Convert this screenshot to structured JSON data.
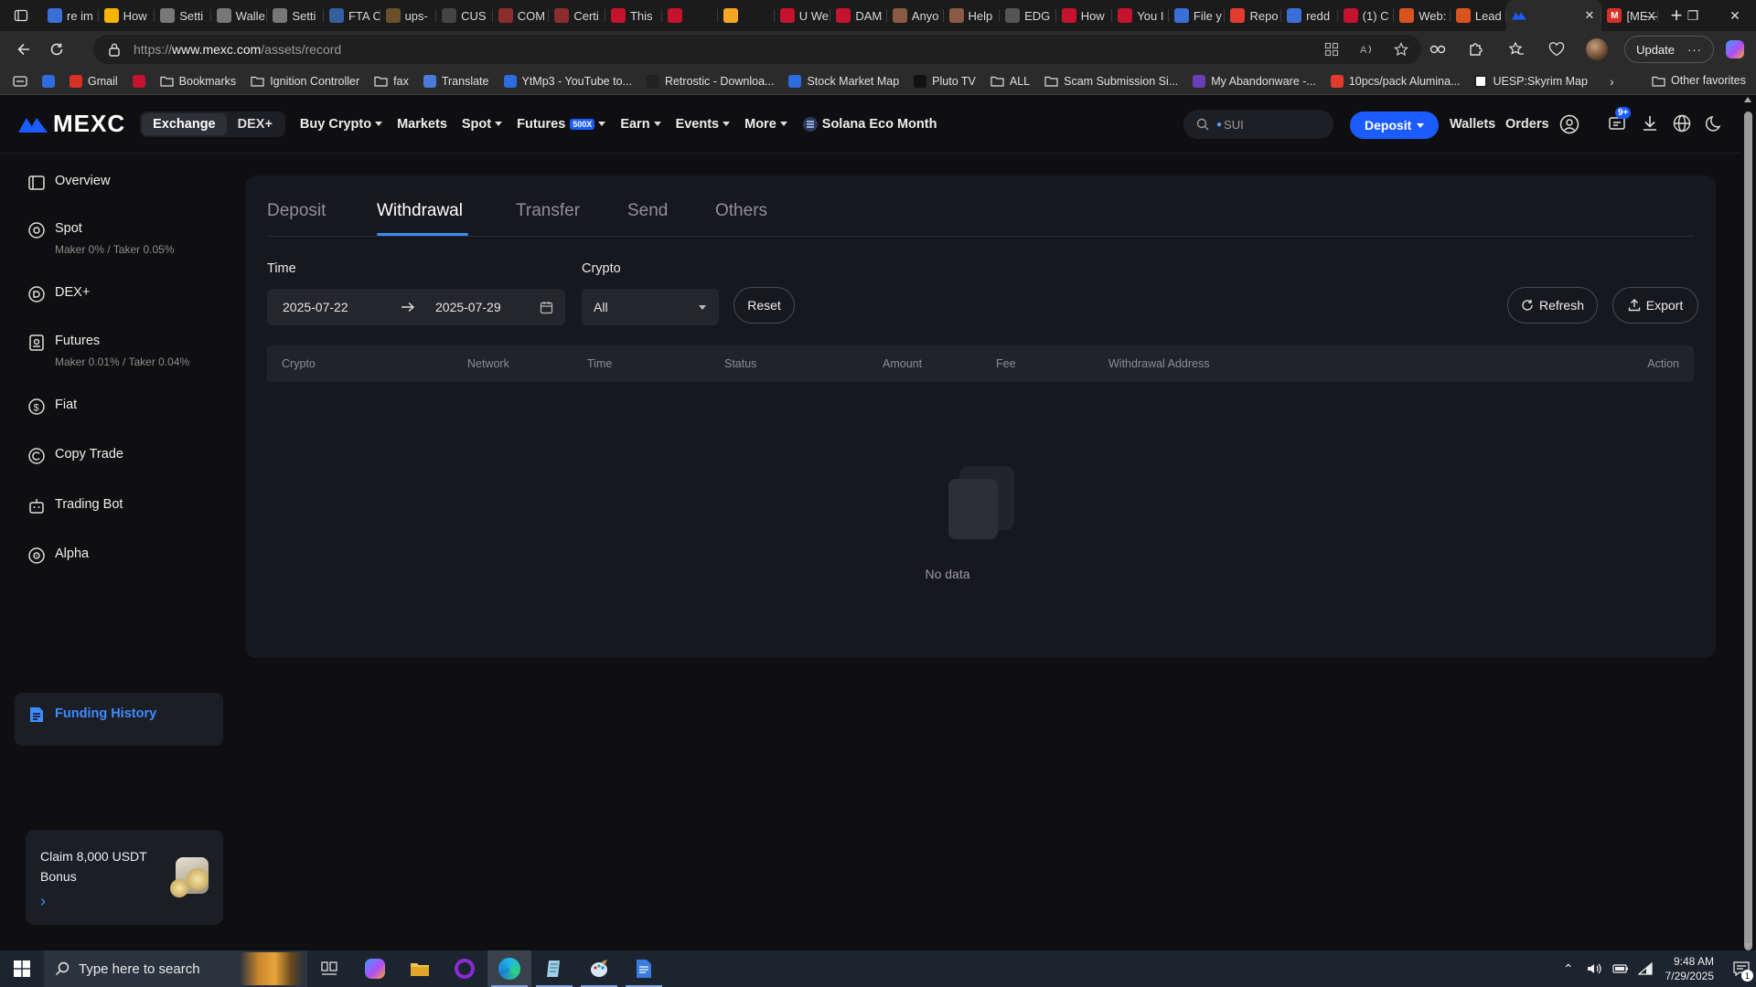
{
  "browser": {
    "tabs": [
      {
        "title": "re im",
        "color": "#3a6fd8",
        "icon": "search-favicon"
      },
      {
        "title": "How",
        "color": "#f4b400",
        "icon": "windows-favicon"
      },
      {
        "title": "Setti",
        "color": "#777777",
        "icon": "gear-favicon"
      },
      {
        "title": "Walle",
        "color": "#777777",
        "icon": "wallet-favicon"
      },
      {
        "title": "Setti",
        "color": "#777777",
        "icon": "gear-favicon"
      },
      {
        "title": "FTA C",
        "color": "#355e9c",
        "icon": "fta-favicon"
      },
      {
        "title": "ups-",
        "color": "#6b4f2b",
        "icon": "ups-favicon"
      },
      {
        "title": "CUS",
        "color": "#444444",
        "icon": "cus-favicon"
      },
      {
        "title": "COM",
        "color": "#8b2d2d",
        "icon": "com-favicon"
      },
      {
        "title": "Certi",
        "color": "#8b2d2d",
        "icon": "cert-favicon"
      },
      {
        "title": "This",
        "color": "#c4122f",
        "icon": "youtube-favicon"
      },
      {
        "title": "",
        "color": "#c4122f",
        "icon": "youtube-favicon"
      },
      {
        "title": "",
        "color": "#f5a623",
        "icon": "warning-favicon"
      },
      {
        "title": "U We",
        "color": "#c4122f",
        "icon": "youtube-favicon"
      },
      {
        "title": "DAM",
        "color": "#c4122f",
        "icon": "youtube-favicon"
      },
      {
        "title": "Anyo",
        "color": "#8a5a44",
        "icon": "reddit-favicon"
      },
      {
        "title": "Help",
        "color": "#8a5a44",
        "icon": "reddit-favicon"
      },
      {
        "title": "EDG",
        "color": "#555555",
        "icon": "edge-favicon"
      },
      {
        "title": "How",
        "color": "#c4122f",
        "icon": "youtube-favicon"
      },
      {
        "title": "You I",
        "color": "#c4122f",
        "icon": "youtube-favicon"
      },
      {
        "title": "File y",
        "color": "#3a6fd8",
        "icon": "search-favicon"
      },
      {
        "title": "Repo",
        "color": "#e23b2e",
        "icon": "report-favicon"
      },
      {
        "title": "redd",
        "color": "#3a6fd8",
        "icon": "search-favicon"
      },
      {
        "title": "(1) C",
        "color": "#c4122f",
        "icon": "youtube-favicon"
      },
      {
        "title": "Web:",
        "color": "#d9531e",
        "icon": "fire-favicon"
      },
      {
        "title": "Lead",
        "color": "#d9531e",
        "icon": "fire-favicon"
      }
    ],
    "active_tab": {
      "title": "",
      "close": "✕",
      "color": "#1a5cff"
    },
    "extra_tab": {
      "title": "[MEX",
      "color": "#d93025"
    },
    "new_tab": "+",
    "url_prefix": "https://",
    "url_domain": "www.mexc.com",
    "url_path": "/assets/record",
    "update_label": "Update",
    "bookmarks": [
      {
        "label": "",
        "color": "#2d6cdf",
        "icon": "edge-bookmark-icon"
      },
      {
        "label": "Gmail",
        "color": "#d93025",
        "icon": "gmail-icon"
      },
      {
        "label": "",
        "color": "#c4122f",
        "icon": "youtube-icon"
      },
      {
        "label": "Bookmarks",
        "color": "folder",
        "icon": "folder-icon"
      },
      {
        "label": "Ignition Controller",
        "color": "folder",
        "icon": "folder-icon"
      },
      {
        "label": "fax",
        "color": "folder",
        "icon": "folder-icon"
      },
      {
        "label": "Translate",
        "color": "#4a7bd8",
        "icon": "translate-icon"
      },
      {
        "label": "YtMp3 - YouTube to...",
        "color": "#2d6cdf",
        "icon": "ytmp3-icon"
      },
      {
        "label": "Retrostic - Downloa...",
        "color": "#222222",
        "icon": "retrostic-icon"
      },
      {
        "label": "Stock Market Map",
        "color": "#2d6cdf",
        "icon": "stock-map-icon"
      },
      {
        "label": "Pluto TV",
        "color": "#111111",
        "icon": "pluto-tv-icon"
      },
      {
        "label": "ALL",
        "color": "folder",
        "icon": "folder-icon"
      },
      {
        "label": "Scam Submission Si...",
        "color": "folder",
        "icon": "folder-icon"
      },
      {
        "label": "My Abandonware -...",
        "color": "#6a3fb5",
        "icon": "abandonware-icon"
      },
      {
        "label": "10pcs/pack Alumina...",
        "color": "#e23b2e",
        "icon": "aliexpress-icon"
      },
      {
        "label": "UESP:Skyrim Map",
        "color": "#ffffff",
        "icon": "uesp-icon"
      }
    ],
    "other_favorites": "Other favorites"
  },
  "site": {
    "logo": "MEXC",
    "seg_exchange": "Exchange",
    "seg_dex": "DEX+",
    "nav": [
      {
        "label": "Buy Crypto",
        "caret": true
      },
      {
        "label": "Markets",
        "caret": false
      },
      {
        "label": "Spot",
        "caret": true
      },
      {
        "label": "Futures",
        "caret": true,
        "badge": "500X"
      },
      {
        "label": "Earn",
        "caret": true
      },
      {
        "label": "Events",
        "caret": true
      },
      {
        "label": "More",
        "caret": true
      }
    ],
    "promo_nav": "Solana Eco Month",
    "search_placeholder": "SUI",
    "deposit_btn": "Deposit",
    "wallets": "Wallets",
    "orders": "Orders",
    "notif_count": "9+",
    "accent": "#1a5cff"
  },
  "sidebar": {
    "items": [
      {
        "label": "Overview",
        "sub": "",
        "icon": "overview-icon"
      },
      {
        "label": "Spot",
        "sub": "Maker 0% / Taker 0.05%",
        "icon": "spot-icon"
      },
      {
        "label": "DEX+",
        "sub": "",
        "icon": "dex-icon"
      },
      {
        "label": "Futures",
        "sub": "Maker 0.01% / Taker 0.04%",
        "icon": "futures-icon"
      },
      {
        "label": "Fiat",
        "sub": "",
        "icon": "fiat-icon"
      },
      {
        "label": "Copy Trade",
        "sub": "",
        "icon": "copy-trade-icon"
      },
      {
        "label": "Trading Bot",
        "sub": "",
        "icon": "trading-bot-icon"
      },
      {
        "label": "Alpha",
        "sub": "",
        "icon": "alpha-icon"
      },
      {
        "label": "Funding History",
        "sub": "",
        "icon": "funding-history-icon"
      }
    ],
    "active_index": 8,
    "promo_line1": "Claim 8,000 USDT",
    "promo_line2": "Bonus"
  },
  "record": {
    "tabs": [
      "Deposit",
      "Withdrawal",
      "Transfer",
      "Send",
      "Others"
    ],
    "active_tab": "Withdrawal",
    "time_label": "Time",
    "date_from": "2025-07-22",
    "date_to": "2025-07-29",
    "crypto_label": "Crypto",
    "crypto_value": "All",
    "reset": "Reset",
    "refresh": "Refresh",
    "export": "Export",
    "columns": [
      "Crypto",
      "Network",
      "Time",
      "Status",
      "Amount",
      "Fee",
      "Withdrawal Address",
      "Action"
    ],
    "rows": [],
    "empty_text": "No data"
  },
  "taskbar": {
    "search_placeholder": "Type here to search",
    "time": "9:48 AM",
    "date": "7/29/2025",
    "notif_badge": "1"
  }
}
